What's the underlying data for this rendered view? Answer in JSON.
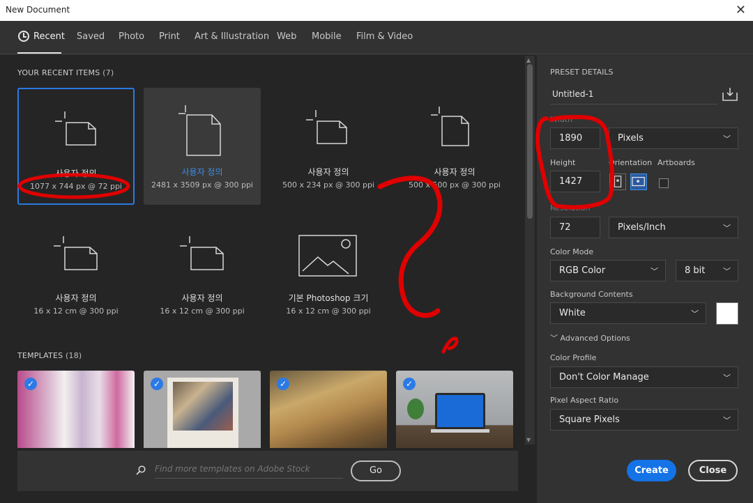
{
  "window": {
    "title": "New Document",
    "close_glyph": "✕"
  },
  "tabs": [
    {
      "label": "Recent"
    },
    {
      "label": "Saved"
    },
    {
      "label": "Photo"
    },
    {
      "label": "Print"
    },
    {
      "label": "Art & Illustration"
    },
    {
      "label": "Web"
    },
    {
      "label": "Mobile"
    },
    {
      "label": "Film & Video"
    }
  ],
  "recent": {
    "title": "YOUR RECENT ITEMS",
    "count": "(7)",
    "items": [
      {
        "name": "사용자 정의",
        "dims": "1077 x 744 px @ 72 ppi"
      },
      {
        "name": "사용자 정의",
        "dims": "2481 x 3509 px @ 300 ppi"
      },
      {
        "name": "사용자 정의",
        "dims": "500 x 234 px @ 300 ppi"
      },
      {
        "name": "사용자 정의",
        "dims": "500 x 500 px @ 300 ppi"
      },
      {
        "name": "사용자 정의",
        "dims": "16 x 12 cm @ 300 ppi"
      },
      {
        "name": "사용자 정의",
        "dims": "16 x 12 cm @ 300 ppi"
      },
      {
        "name": "기본 Photoshop 크기",
        "dims": "16 x 12 cm @ 300 ppi"
      }
    ]
  },
  "templates": {
    "title": "TEMPLATES",
    "count": "(18)",
    "check_glyph": "✓"
  },
  "search": {
    "placeholder": "Find more templates on Adobe Stock",
    "go_label": "Go"
  },
  "preset": {
    "header": "PRESET DETAILS",
    "name": "Untitled-1",
    "width_label": "Width",
    "width_value": "1890",
    "width_unit": "Pixels",
    "height_label": "Height",
    "height_value": "1427",
    "orientation_label": "Orientation",
    "artboards_label": "Artboards",
    "resolution_label": "Resolution",
    "resolution_value": "72",
    "resolution_unit": "Pixels/Inch",
    "color_mode_label": "Color Mode",
    "color_mode": "RGB Color",
    "bit_depth": "8 bit",
    "background_label": "Background Contents",
    "background": "White",
    "advanced_label": "Advanced Options",
    "profile_label": "Color Profile",
    "profile": "Don't Color Manage",
    "aspect_label": "Pixel Aspect Ratio",
    "aspect": "Square Pixels",
    "create_label": "Create",
    "close_label": "Close"
  },
  "colors": {
    "accent": "#1473e6",
    "annotation": "#e00000"
  }
}
